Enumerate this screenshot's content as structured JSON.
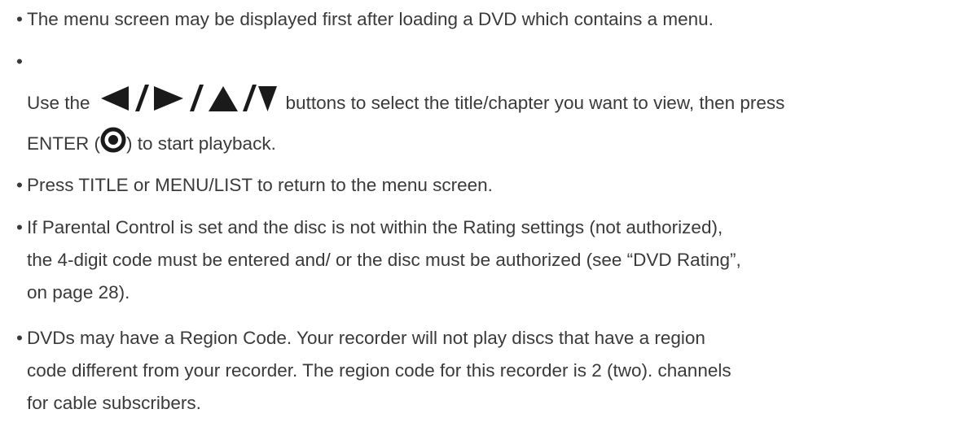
{
  "bullet": "•",
  "items": [
    {
      "text": "The menu screen may be displayed first after loading a DVD which contains a menu."
    },
    {
      "line1_before": "Use the",
      "arrows_icon": "left-right-up-down-arrow-buttons-icon",
      "line1_after": "buttons to select the title/chapter you want to view, then press",
      "line2_before": "ENTER (",
      "enter_icon": "enter-button-icon",
      "line2_after": ") to start playback."
    },
    {
      "text": "Press TITLE or MENU/LIST to return to the menu screen."
    },
    {
      "lines": [
        "If Parental Control is set and the disc is not within the Rating settings (not authorized),",
        "the 4-digit code must be entered and/ or the disc must be authorized (see “DVD Rating”,",
        "on page 28)."
      ]
    },
    {
      "lines": [
        "DVDs may have a Region Code. Your recorder will not play discs that have a region",
        "code different from your recorder. The region code for this recorder is 2 (two). channels",
        "for cable subscribers."
      ]
    }
  ],
  "colors": {
    "text": "#3a3a3a",
    "icon": "#1a1a1a"
  }
}
